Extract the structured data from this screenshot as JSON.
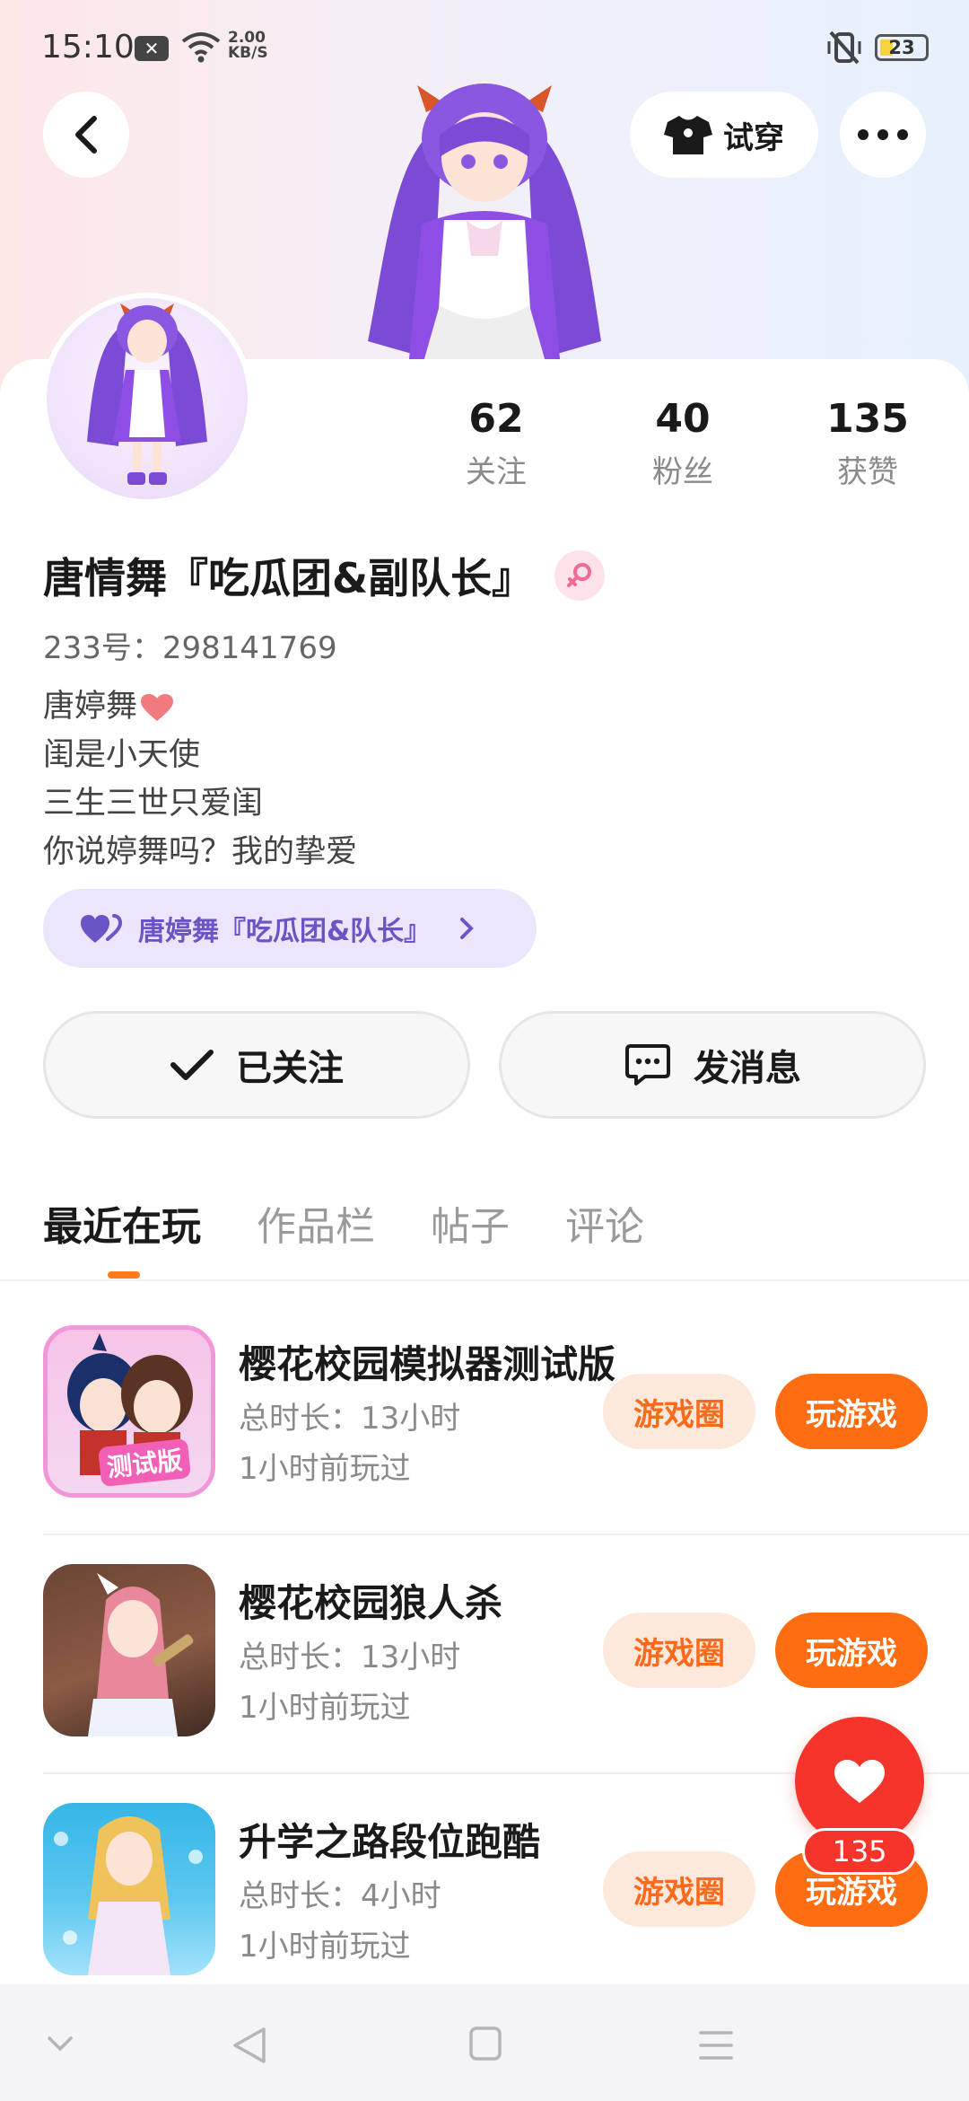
{
  "status_bar": {
    "time": "15:10",
    "notification_icon": "close-box-icon",
    "speed_value": "2.00",
    "speed_unit": "KB/S",
    "battery": "23"
  },
  "header": {
    "tryon_label": "试穿"
  },
  "profile": {
    "stats": [
      {
        "value": "62",
        "label": "关注"
      },
      {
        "value": "40",
        "label": "粉丝"
      },
      {
        "value": "135",
        "label": "获赞"
      }
    ],
    "name": "唐情舞『吃瓜团&副队长』",
    "uid": "233号：298141769",
    "bio": [
      "唐婷舞",
      "闺是小天使",
      "三生三世只爱闺",
      "你说婷舞吗？我的挚爱"
    ],
    "cp_label": "唐婷舞『吃瓜团&队长』",
    "follow_label": "已关注",
    "message_label": "发消息"
  },
  "tabs": [
    "最近在玩",
    "作品栏",
    "帖子",
    "评论"
  ],
  "games": [
    {
      "title": "樱花校园模拟器测试版",
      "total_time": "总时长：13小时",
      "last_played": "1小时前玩过",
      "circle_label": "游戏圈",
      "play_label": "玩游戏",
      "badge": "测试版"
    },
    {
      "title": "樱花校园狼人杀",
      "total_time": "总时长：13小时",
      "last_played": "1小时前玩过",
      "circle_label": "游戏圈",
      "play_label": "玩游戏"
    },
    {
      "title": "升学之路段位跑酷",
      "total_time": "总时长：4小时",
      "last_played": "1小时前玩过",
      "circle_label": "游戏圈",
      "play_label": "玩游戏"
    }
  ],
  "like_fab": {
    "count": "135"
  },
  "colors": {
    "accent": "#ff6d12",
    "like": "#f5352c",
    "cp_chip": "#ebe6fb",
    "cp_text": "#6a55c4"
  }
}
